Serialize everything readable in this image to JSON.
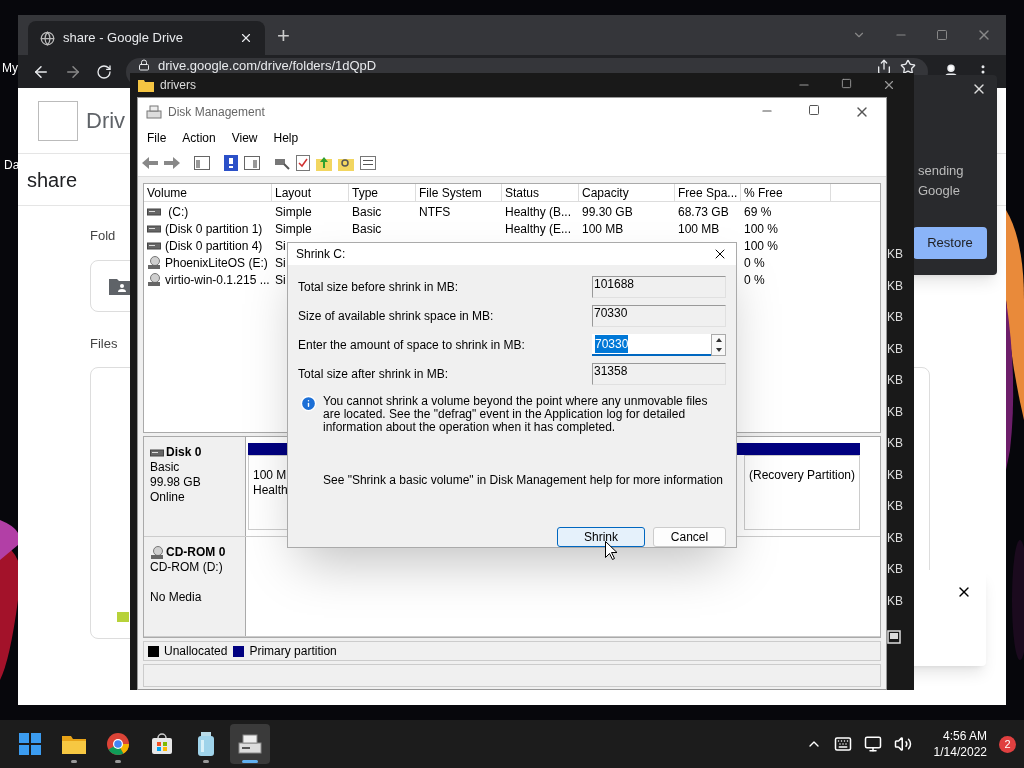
{
  "desktop": {
    "icon_labels": [
      "My",
      "Da"
    ]
  },
  "browser": {
    "tab": {
      "title": "share - Google Drive"
    },
    "new_tab": "+",
    "address": "drive.google.com/drive/folders/1dQpD",
    "page": {
      "logo_text": "Driv",
      "folder_title": "share",
      "sections": [
        "Fold",
        "Files"
      ],
      "restore_popup": {
        "lines": [
          "sending",
          "Google"
        ],
        "button": "Restore"
      }
    }
  },
  "drivers_window": {
    "title": "drivers",
    "sizes": [
      "KB",
      "KB",
      "KB",
      "KB",
      "KB",
      "KB",
      "KB",
      "KB",
      "KB",
      "KB",
      "KB",
      "KB"
    ]
  },
  "disk_management": {
    "title": "Disk Management",
    "menu": [
      "File",
      "Action",
      "View",
      "Help"
    ],
    "columns": [
      "Volume",
      "Layout",
      "Type",
      "File System",
      "Status",
      "Capacity",
      "Free Spa...",
      "% Free"
    ],
    "rows": [
      {
        "kind": "disk",
        "volume": " (C:)",
        "layout": "Simple",
        "type": "Basic",
        "file_system": "NTFS",
        "status": "Healthy (B...",
        "capacity": "99.30 GB",
        "free_space": "68.73 GB",
        "percent_free": "69 %"
      },
      {
        "kind": "disk",
        "volume": "(Disk 0 partition 1)",
        "layout": "Simple",
        "type": "Basic",
        "status": "Healthy (E...",
        "capacity": "100 MB",
        "free_space": "100 MB",
        "percent_free": "100 %"
      },
      {
        "kind": "disk",
        "volume": "(Disk 0 partition 4)",
        "layout": "Si",
        "percent_free": "100 %"
      },
      {
        "kind": "cd",
        "volume": "PhoenixLiteOS (E:)",
        "layout": "Si",
        "percent_free": "0 %"
      },
      {
        "kind": "cd",
        "volume": "virtio-win-0.1.215 ...",
        "layout": "Si",
        "percent_free": "0 %"
      }
    ],
    "disks": [
      {
        "kind": "disk",
        "name": "Disk 0",
        "lines": [
          "Basic",
          "99.98 GB",
          "Online"
        ],
        "partitions": [
          {
            "lines": [
              "100 M",
              "Health"
            ]
          },
          {
            "lines": [
              "(Recovery Partition)"
            ]
          }
        ]
      },
      {
        "kind": "cd",
        "name": "CD-ROM 0",
        "lines": [
          "CD-ROM (D:)",
          "No Media"
        ]
      }
    ],
    "legend": [
      {
        "label": "Unallocated",
        "color": "#000000"
      },
      {
        "label": "Primary partition",
        "color": "#000080"
      }
    ]
  },
  "dialog": {
    "title": "Shrink C:",
    "fields": [
      {
        "kind": "readonly",
        "label": "Total size before shrink in MB:",
        "value": "101688"
      },
      {
        "kind": "readonly",
        "label": "Size of available shrink space in MB:",
        "value": "70330"
      },
      {
        "kind": "spin",
        "label": "Enter the amount of space to shrink in MB:",
        "value": "70330"
      },
      {
        "kind": "readonly",
        "label": "Total size after shrink in MB:",
        "value": "31358"
      }
    ],
    "info": "You cannot shrink a volume beyond the point where any unmovable files are located. See the \"defrag\" event in the Application log for detailed information about the operation when it has completed.",
    "help": "See \"Shrink a basic volume\" in Disk Management help for more information",
    "buttons": [
      {
        "label": "Shrink",
        "default": true
      },
      {
        "label": "Cancel",
        "default": false
      }
    ]
  },
  "taskbar": {
    "apps": [
      {
        "kind": "start",
        "running": false,
        "active": false
      },
      {
        "kind": "folder",
        "running": true,
        "active": false
      },
      {
        "kind": "chrome",
        "running": true,
        "active": false
      },
      {
        "kind": "store",
        "running": false,
        "active": false
      },
      {
        "kind": "jar",
        "running": true,
        "active": false
      },
      {
        "kind": "diskmgmt",
        "running": true,
        "active": true
      }
    ],
    "time": "4:56 AM",
    "date": "1/14/2022",
    "notifications": "2"
  }
}
